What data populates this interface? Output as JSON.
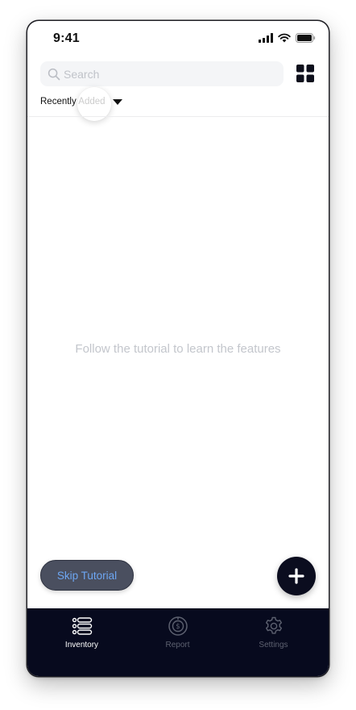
{
  "status_bar": {
    "time": "9:41"
  },
  "search": {
    "placeholder": "Search"
  },
  "sort": {
    "label": "Recently Added"
  },
  "empty_state": {
    "message": "Follow the tutorial to learn the features"
  },
  "actions": {
    "skip_label": "Skip Tutorial"
  },
  "tab_bar": {
    "tabs": [
      {
        "label": "Inventory",
        "icon": "list-icon",
        "active": true
      },
      {
        "label": "Report",
        "icon": "report-icon",
        "active": false
      },
      {
        "label": "Settings",
        "icon": "gear-icon",
        "active": false
      }
    ]
  },
  "colors": {
    "tab_bar_background": "#070a1e",
    "fab_background": "#0b0d1f",
    "skip_text": "#6da6f2",
    "hint_text": "#c3c6cc"
  }
}
